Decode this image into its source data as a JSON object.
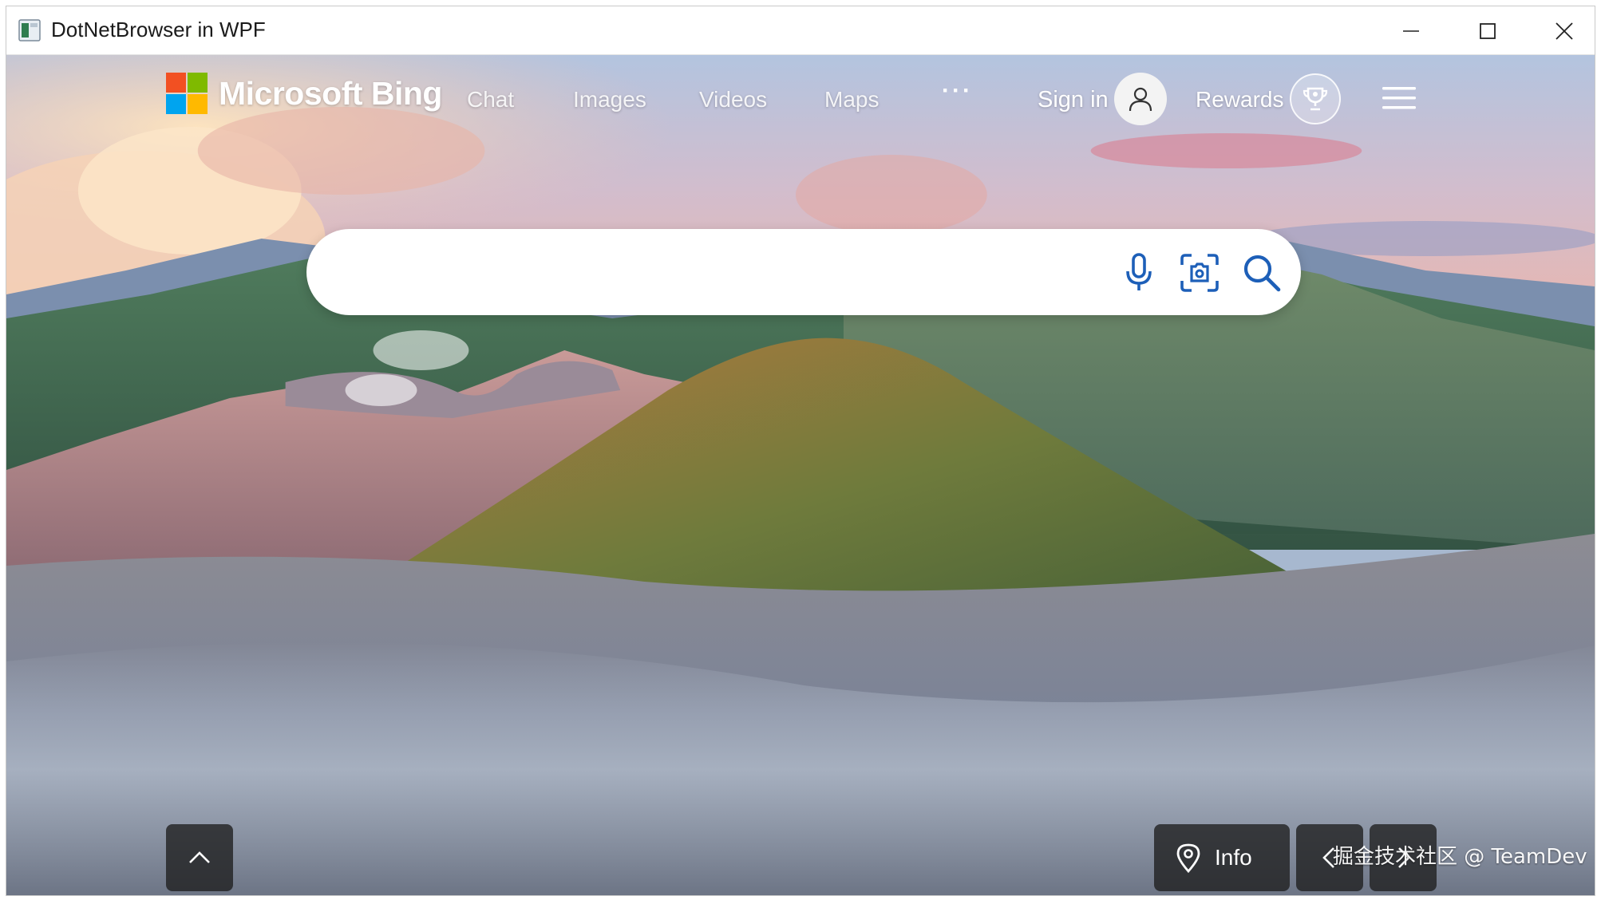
{
  "window": {
    "title": "DotNetBrowser in WPF"
  },
  "brand": {
    "name": "Microsoft Bing"
  },
  "nav": {
    "links": [
      "Chat",
      "Images",
      "Videos",
      "Maps"
    ],
    "more": "···",
    "sign_in": "Sign in",
    "rewards": "Rewards"
  },
  "search": {
    "value": "",
    "placeholder": ""
  },
  "footer": {
    "info_label": "Info"
  },
  "watermark": "掘金技术社区 @ TeamDev",
  "icons": {
    "app": "app-window-icon",
    "minimize": "minimize-icon",
    "maximize": "maximize-icon",
    "close": "close-icon",
    "logo": "microsoft-logo-icon",
    "user": "user-icon",
    "trophy": "trophy-icon",
    "menu": "hamburger-menu-icon",
    "mic": "microphone-icon",
    "visual_search": "visual-search-icon",
    "search": "search-icon",
    "up": "chevron-up-icon",
    "pin": "location-pin-icon",
    "prev": "chevron-left-icon",
    "next": "chevron-right-icon"
  },
  "colors": {
    "accent": "#0f6cbd",
    "logo_red": "#f25022",
    "logo_green": "#7fba00",
    "logo_blue": "#00a4ef",
    "logo_yellow": "#ffb900"
  }
}
